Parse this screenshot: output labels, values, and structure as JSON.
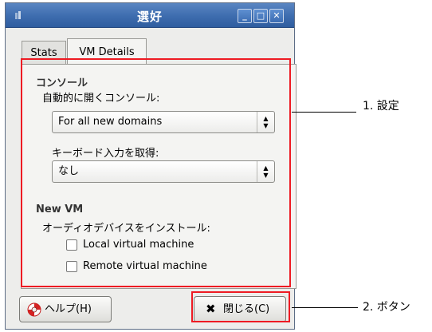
{
  "window": {
    "title": "選好",
    "buttons": {
      "minimize": "_",
      "maximize": "□",
      "close": "✕"
    }
  },
  "tabs": [
    {
      "label": "Stats",
      "active": false
    },
    {
      "label": "VM Details",
      "active": true
    }
  ],
  "console_section": {
    "title": "コンソール",
    "open_console_label": "自動的に開くコンソール:",
    "open_console_value": "For all new domains",
    "grab_keyboard_label": "キーボード入力を取得:",
    "grab_keyboard_value": "なし"
  },
  "new_vm_section": {
    "title": "New VM",
    "install_audio_label": "オーディオデバイスをインストール:",
    "checkboxes": [
      {
        "label": "Local virtual machine",
        "checked": false
      },
      {
        "label": "Remote virtual machine",
        "checked": false
      }
    ]
  },
  "buttons": {
    "help_label": "ヘルプ(H)",
    "close_label": "閉じる(C)"
  },
  "annotations": {
    "settings": "1. 設定",
    "button": "2. ボタン"
  },
  "colors": {
    "titlebar": "#3d6cae",
    "highlight": "#ee1b23"
  }
}
